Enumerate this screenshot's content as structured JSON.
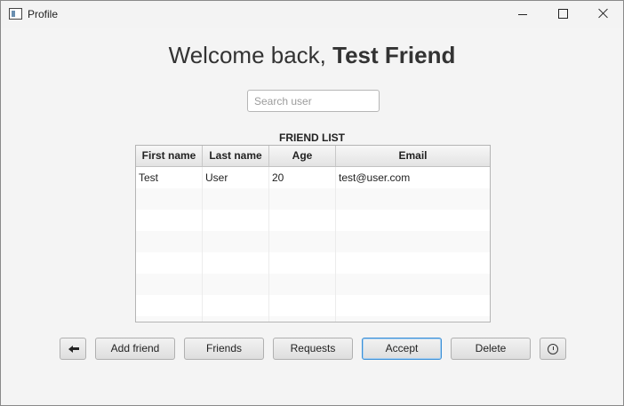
{
  "window": {
    "title": "Profile",
    "icons": {
      "app": "app-window-icon",
      "minimize": "minimize-icon",
      "maximize": "maximize-icon",
      "close": "close-icon"
    }
  },
  "header": {
    "greeting": "Welcome back, ",
    "user_name": "Test Friend"
  },
  "search": {
    "placeholder": "Search user",
    "value": ""
  },
  "friend_list": {
    "label": "FRIEND LIST",
    "columns": [
      "First name",
      "Last name",
      "Age",
      "Email"
    ],
    "rows": [
      [
        "Test",
        "User",
        "20",
        "test@user.com"
      ],
      [
        "",
        "",
        "",
        ""
      ],
      [
        "",
        "",
        "",
        ""
      ],
      [
        "",
        "",
        "",
        ""
      ],
      [
        "",
        "",
        "",
        ""
      ],
      [
        "",
        "",
        "",
        ""
      ],
      [
        "",
        "",
        "",
        ""
      ],
      [
        "",
        "",
        "",
        ""
      ]
    ]
  },
  "actions": {
    "back_icon": "back-arrow-icon",
    "add_friend": "Add friend",
    "friends": "Friends",
    "requests": "Requests",
    "accept": "Accept",
    "delete": "Delete",
    "history_icon": "clock-icon"
  }
}
